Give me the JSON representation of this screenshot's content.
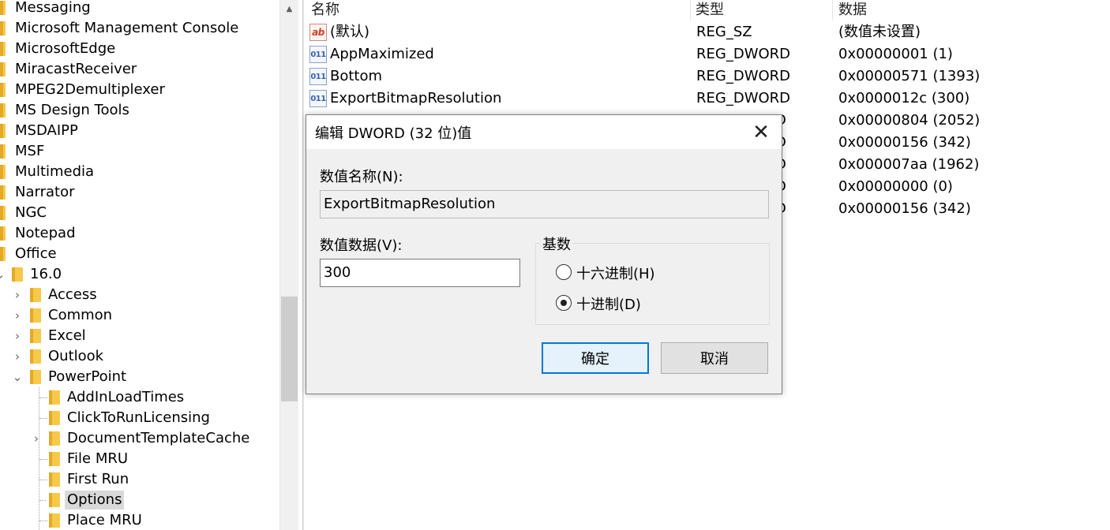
{
  "tree": {
    "items": [
      {
        "label": "Messaging"
      },
      {
        "label": "Microsoft Management Console"
      },
      {
        "label": "MicrosoftEdge"
      },
      {
        "label": "MiracastReceiver"
      },
      {
        "label": "MPEG2Demultiplexer"
      },
      {
        "label": "MS Design Tools"
      },
      {
        "label": "MSDAIPP"
      },
      {
        "label": "MSF"
      },
      {
        "label": "Multimedia"
      },
      {
        "label": "Narrator"
      },
      {
        "label": "NGC"
      },
      {
        "label": "Notepad"
      },
      {
        "label": "Office"
      },
      {
        "label": "16.0"
      },
      {
        "label": "Access"
      },
      {
        "label": "Common"
      },
      {
        "label": "Excel"
      },
      {
        "label": "Outlook"
      },
      {
        "label": "PowerPoint"
      },
      {
        "label": "AddInLoadTimes"
      },
      {
        "label": "ClickToRunLicensing"
      },
      {
        "label": "DocumentTemplateCache"
      },
      {
        "label": "File MRU"
      },
      {
        "label": "First Run"
      },
      {
        "label": "Options"
      },
      {
        "label": "Place MRU"
      }
    ],
    "selected": "Options"
  },
  "list": {
    "headers": {
      "name": "名称",
      "type": "类型",
      "data": "数据"
    },
    "rows": [
      {
        "icon": "string-value-icon",
        "icon_text": "ab",
        "name": "(默认)",
        "type": "REG_SZ",
        "data": "(数值未设置)"
      },
      {
        "icon": "binary-value-icon",
        "icon_text": "011",
        "name": "AppMaximized",
        "type": "REG_DWORD",
        "data": "0x00000001 (1)"
      },
      {
        "icon": "binary-value-icon",
        "icon_text": "011",
        "name": "Bottom",
        "type": "REG_DWORD",
        "data": "0x00000571 (1393)"
      },
      {
        "icon": "binary-value-icon",
        "icon_text": "011",
        "name": "ExportBitmapResolution",
        "type": "REG_DWORD",
        "data": "0x0000012c (300)"
      },
      {
        "type": "D",
        "data": "0x00000804 (2052)"
      },
      {
        "type": "D",
        "data": "0x00000156 (342)"
      },
      {
        "type": "D",
        "data": "0x000007aa (1962)"
      },
      {
        "type": "D",
        "data": "0x00000000 (0)"
      },
      {
        "type": "D",
        "data": "0x00000156 (342)"
      }
    ]
  },
  "dialog": {
    "title": "编辑 DWORD (32 位)值",
    "close_glyph": "✕",
    "value_name_label": "数值名称(N):",
    "value_name": "ExportBitmapResolution",
    "value_data_label": "数值数据(V):",
    "value_data": "300",
    "base_label": "基数",
    "hex_label": "十六进制(H)",
    "dec_label": "十进制(D)",
    "selected_base": "decimal",
    "ok_label": "确定",
    "cancel_label": "取消"
  },
  "colors": {
    "folder": "#f7c948",
    "dialog_accent": "#0078d7",
    "selection": "#d9d9d9"
  }
}
